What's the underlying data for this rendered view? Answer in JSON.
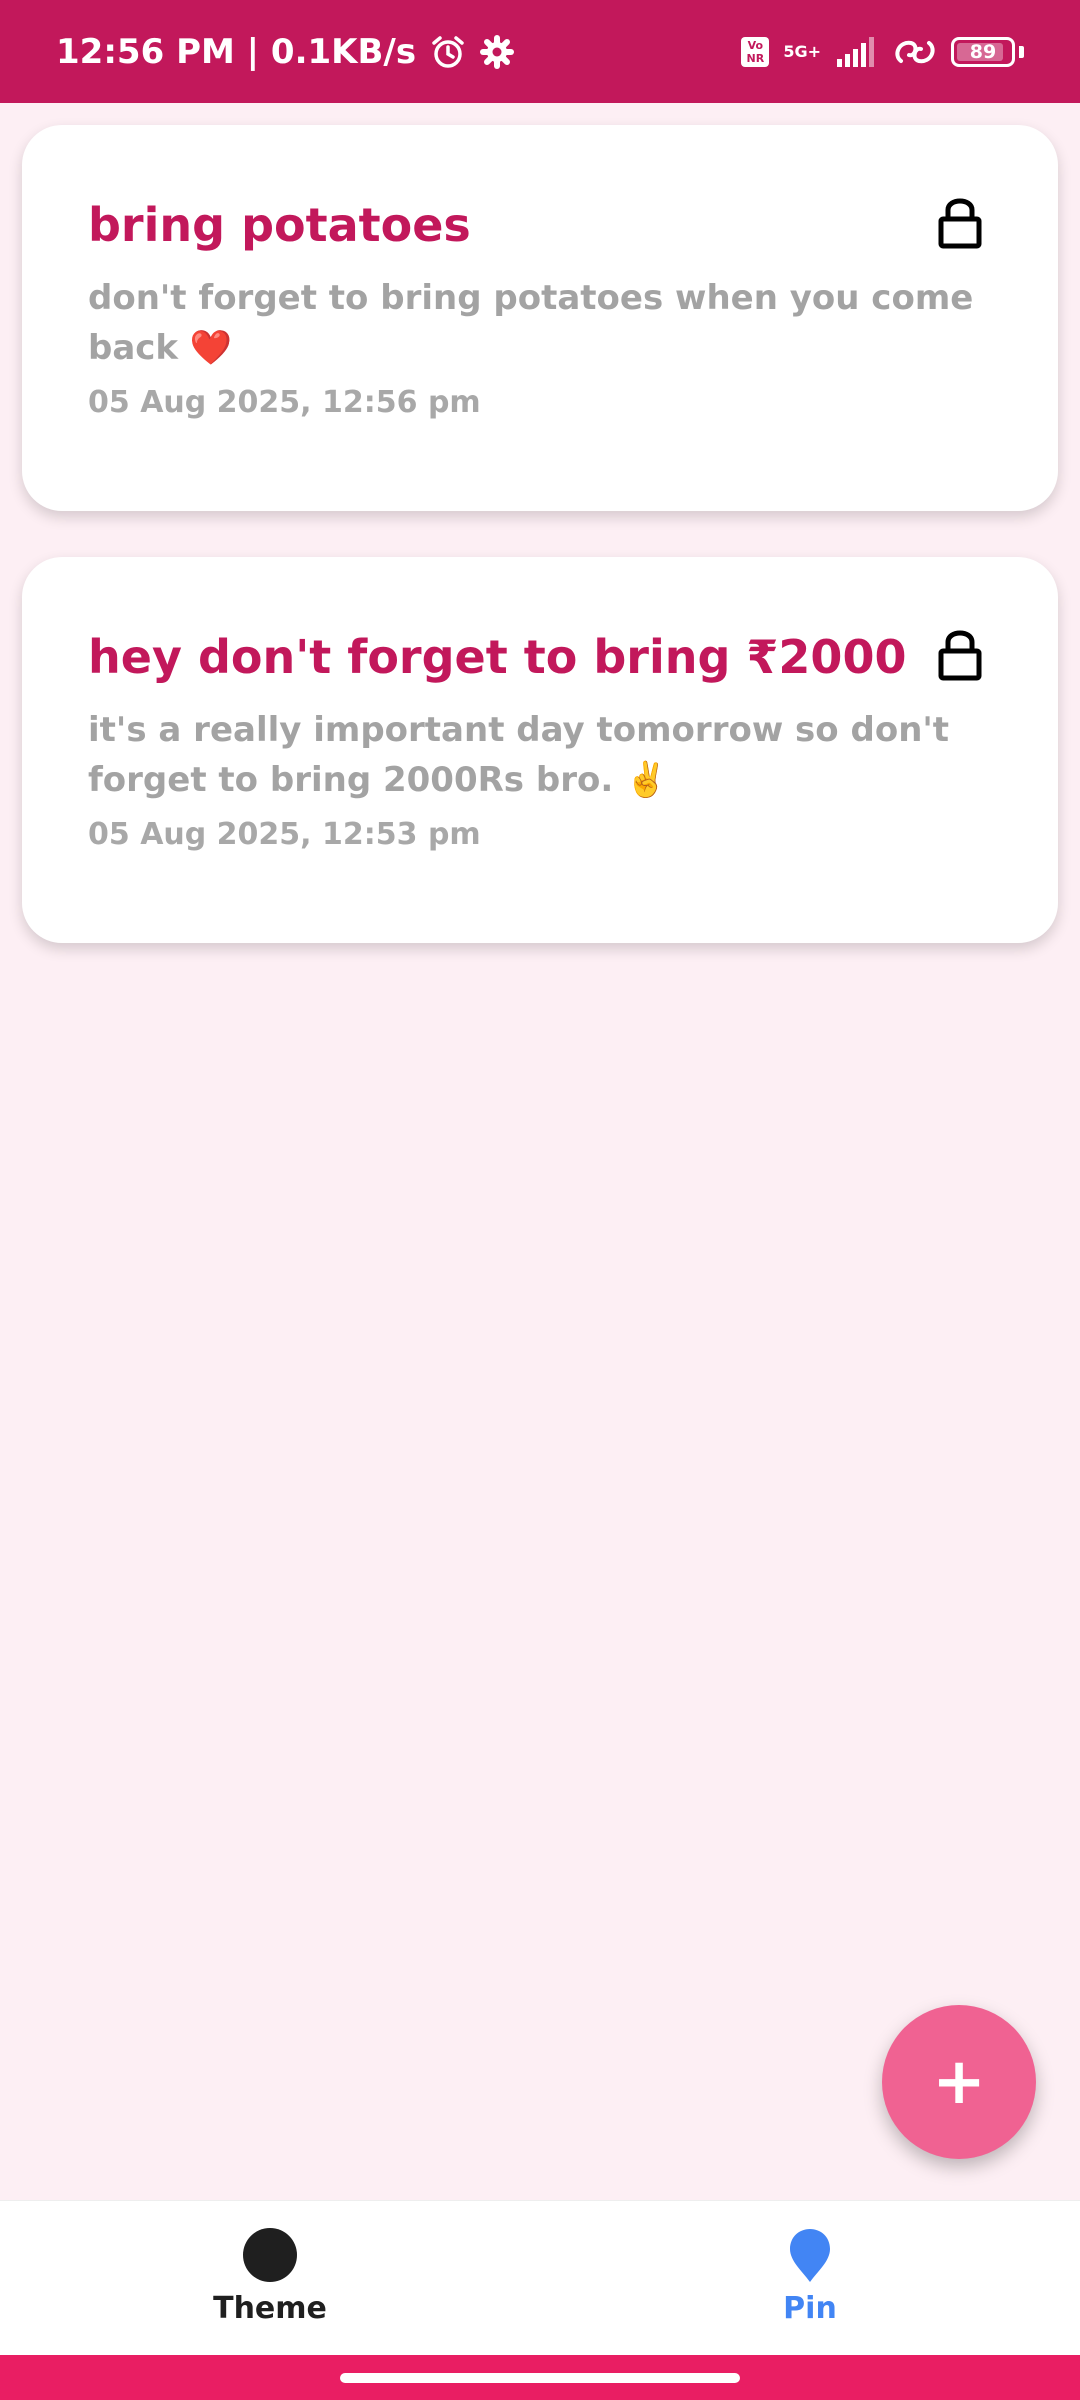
{
  "status_bar": {
    "time_speed": "12:56 PM | 0.1KB/s",
    "volte": "Vo\nNR",
    "network": "5G+",
    "battery": "89",
    "battery_level": 0.89
  },
  "notes": [
    {
      "title": "bring potatoes",
      "body": "don't forget to bring potatoes when you come back ❤️",
      "date": "05 Aug 2025, 12:56 pm",
      "locked": true
    },
    {
      "title": "hey don't forget to bring ₹2000",
      "body": "it's a really important day tomorrow so don't forget to bring 2000Rs bro. ✌️",
      "date": "05 Aug 2025, 12:53 pm",
      "locked": true
    }
  ],
  "fab": {
    "label": "+"
  },
  "bottom_nav": {
    "items": [
      {
        "label": "Theme",
        "icon": "circle-icon"
      },
      {
        "label": "Pin",
        "icon": "pin-icon"
      }
    ]
  },
  "colors": {
    "primary": "#c2185b",
    "accent": "#f06292",
    "background": "#fdeff4",
    "pin_active": "#4285f4"
  }
}
